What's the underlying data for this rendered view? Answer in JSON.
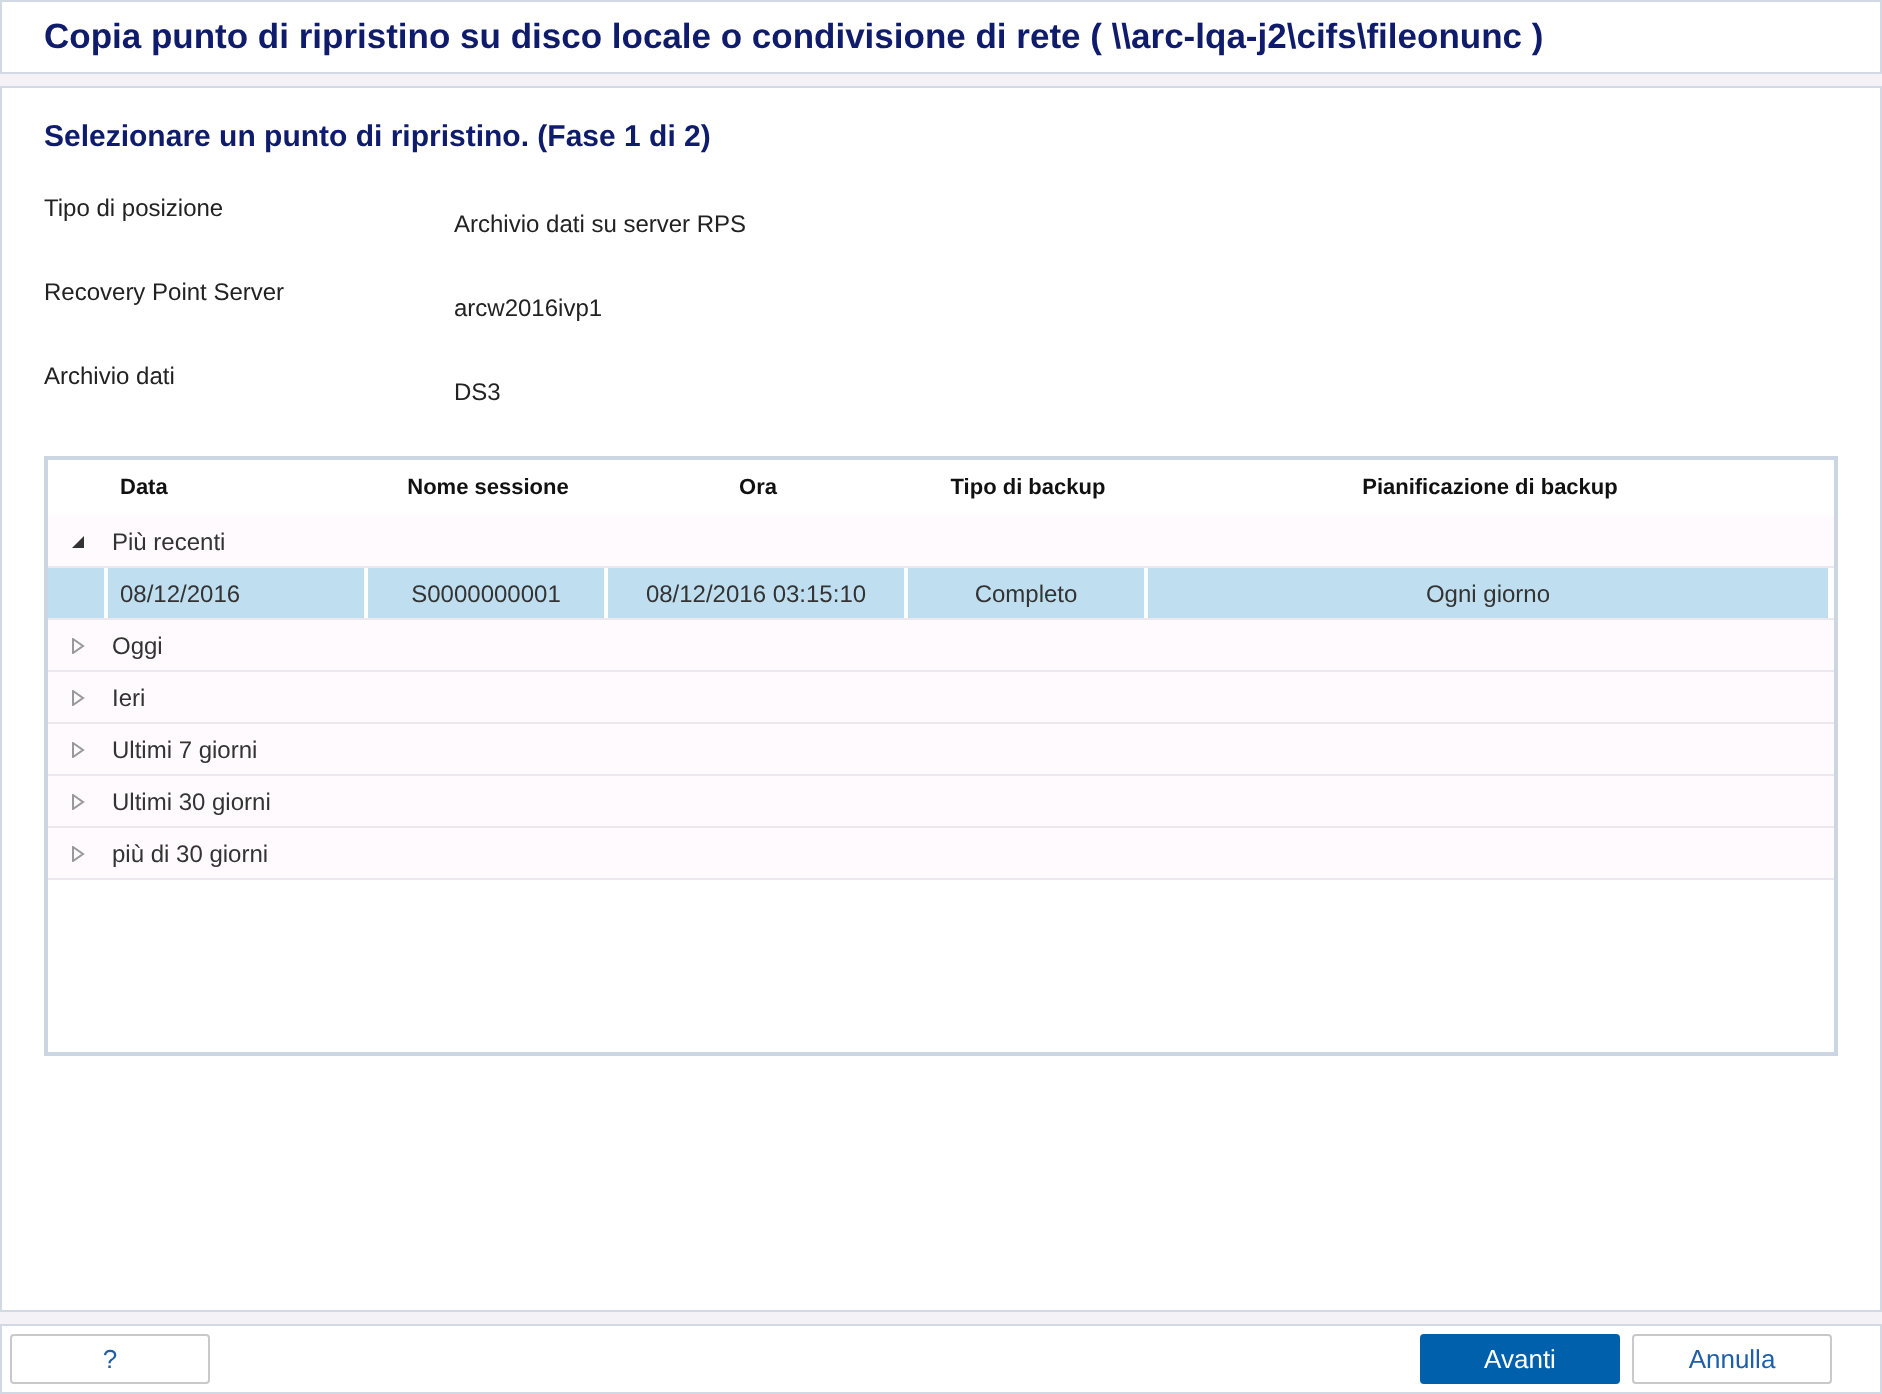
{
  "window": {
    "title": "Copia punto di ripristino su disco locale o condivisione di rete ( \\\\arc-lqa-j2\\cifs\\fileonunc )"
  },
  "step_title": "Selezionare un punto di ripristino. (Fase 1 di 2)",
  "fields": [
    {
      "label": "Tipo di posizione",
      "value": "Archivio dati su server RPS"
    },
    {
      "label": "Recovery Point Server",
      "value": "arcw2016ivp1"
    },
    {
      "label": "Archivio dati",
      "value": "DS3"
    }
  ],
  "table": {
    "columns": [
      "Data",
      "Nome sessione",
      "Ora",
      "Tipo di backup",
      "Pianificazione di backup"
    ],
    "groups": [
      {
        "label": "Più recenti",
        "expanded": true,
        "rows": [
          {
            "cells": [
              "08/12/2016",
              "S0000000001",
              "08/12/2016 03:15:10",
              "Completo",
              "Ogni giorno"
            ],
            "selected": true
          }
        ]
      },
      {
        "label": "Oggi",
        "expanded": false
      },
      {
        "label": "Ieri",
        "expanded": false
      },
      {
        "label": "Ultimi 7 giorni",
        "expanded": false
      },
      {
        "label": "Ultimi 30 giorni",
        "expanded": false
      },
      {
        "label": "più di 30 giorni",
        "expanded": false
      }
    ]
  },
  "buttons": {
    "help": "?",
    "next": "Avanti",
    "cancel": "Annulla"
  }
}
